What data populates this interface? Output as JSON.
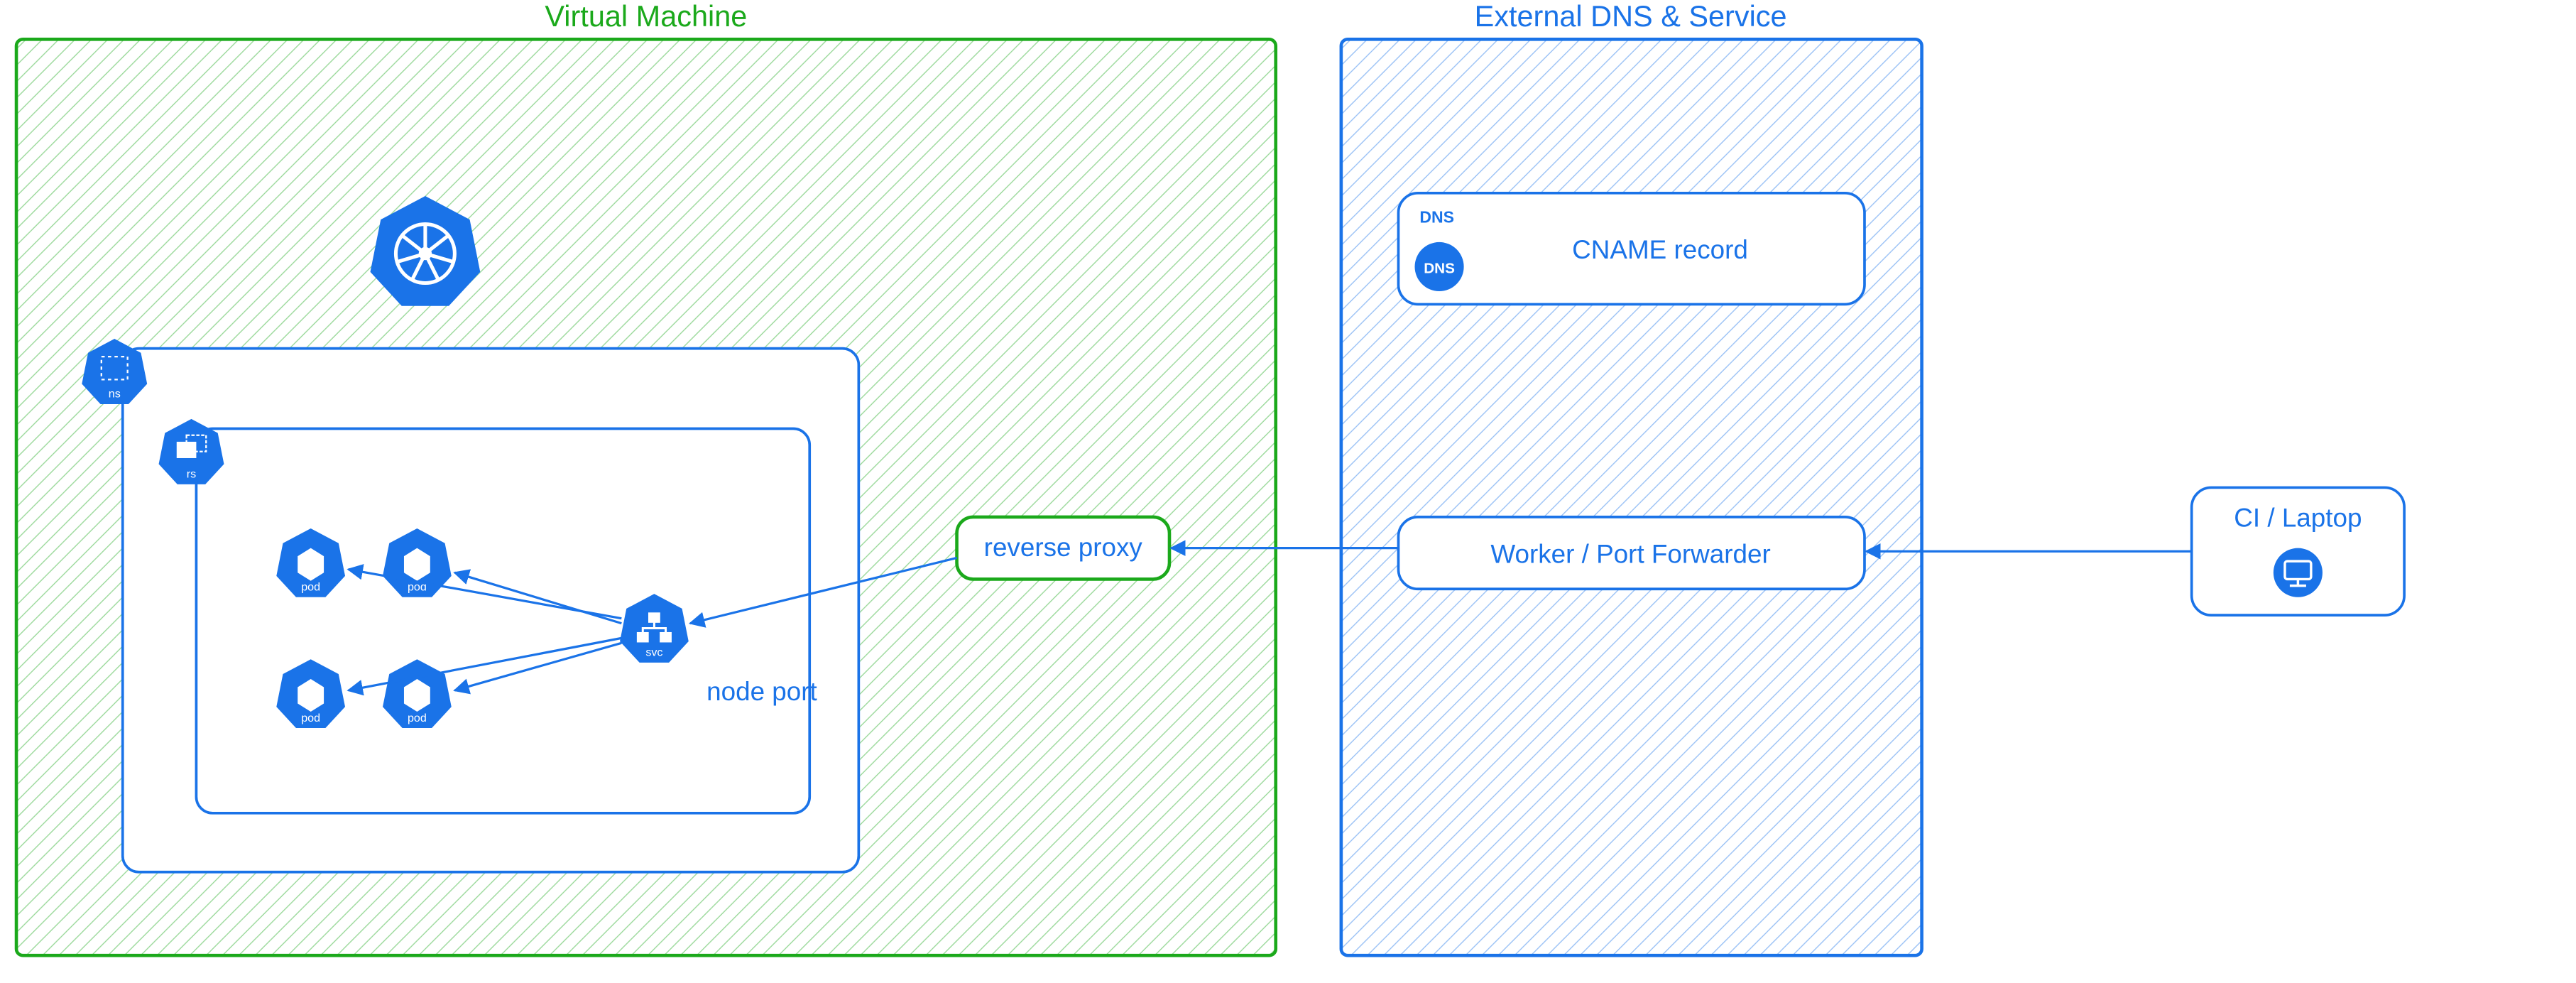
{
  "titles": {
    "vm": "Virtual Machine",
    "ext": "External DNS & Service"
  },
  "nodes": {
    "reverse_proxy": "reverse proxy",
    "node_port": "node port",
    "cname": "CNAME record",
    "dns_badge": "DNS",
    "dns_circle": "DNS",
    "worker": "Worker / Port Forwarder",
    "ci": "CI / Laptop"
  },
  "k8s_icons": {
    "ns": "ns",
    "rs": "rs",
    "svc": "svc",
    "pod1": "pod",
    "pod2": "pod",
    "pod3": "pod",
    "pod4": "pod"
  },
  "colors": {
    "green": "#1ba91b",
    "blue": "#1a73e8",
    "white": "#ffffff"
  }
}
